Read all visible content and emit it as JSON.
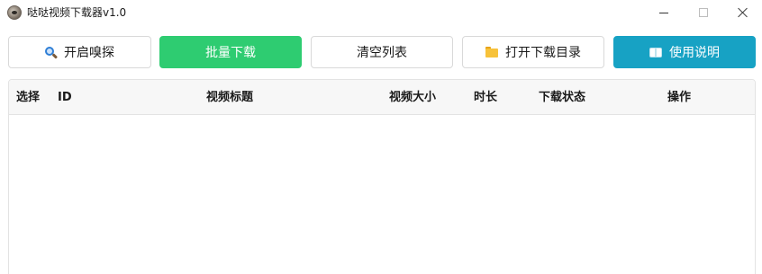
{
  "window": {
    "title": "哒哒视频下载器v1.0",
    "controls": {
      "minimize": "minimize",
      "maximize": "maximize",
      "close": "close"
    }
  },
  "toolbar": {
    "sniff_label": "开启嗅探",
    "sniff_icon": "search-icon",
    "batch_download_label": "批量下载",
    "clear_list_label": "清空列表",
    "open_folder_label": "打开下载目录",
    "open_folder_icon": "folder-icon",
    "help_label": "使用说明",
    "help_icon": "book-icon"
  },
  "colors": {
    "batch_download": "#2ecc71",
    "help": "#17a2c4"
  },
  "table": {
    "columns": [
      "选择",
      "ID",
      "视频标题",
      "视频大小",
      "时长",
      "下载状态",
      "操作"
    ],
    "rows": []
  }
}
